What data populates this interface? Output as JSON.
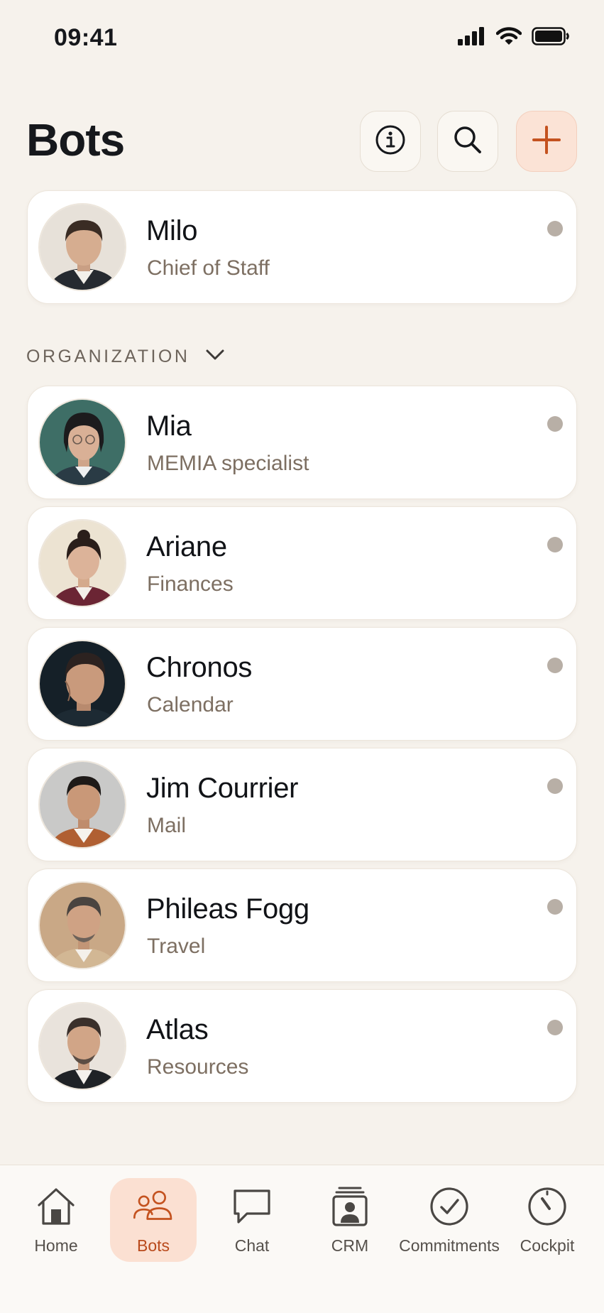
{
  "status_bar": {
    "time": "09:41"
  },
  "header": {
    "title": "Bots"
  },
  "pinned": [
    {
      "name": "Milo",
      "role": "Chief of Staff"
    }
  ],
  "section": {
    "label": "ORGANIZATION"
  },
  "bots": [
    {
      "name": "Mia",
      "role": "MEMIA specialist"
    },
    {
      "name": "Ariane",
      "role": "Finances"
    },
    {
      "name": "Chronos",
      "role": "Calendar"
    },
    {
      "name": "Jim Courrier",
      "role": "Mail"
    },
    {
      "name": "Phileas Fogg",
      "role": "Travel"
    },
    {
      "name": "Atlas",
      "role": "Resources"
    }
  ],
  "tabs": [
    {
      "label": "Home",
      "icon": "home-icon"
    },
    {
      "label": "Bots",
      "icon": "people-icon",
      "active": true
    },
    {
      "label": "Chat",
      "icon": "chat-bubble-icon"
    },
    {
      "label": "CRM",
      "icon": "contact-card-icon"
    },
    {
      "label": "Commitments",
      "icon": "checkmark-circle-icon"
    },
    {
      "label": "Cockpit",
      "icon": "gauge-icon"
    }
  ],
  "colors": {
    "background": "#f6f2ec",
    "accent": "#c4521f",
    "accent_soft": "#fbe0d2",
    "status_dot": "#b8afa6",
    "role_text": "#7d6f62"
  }
}
